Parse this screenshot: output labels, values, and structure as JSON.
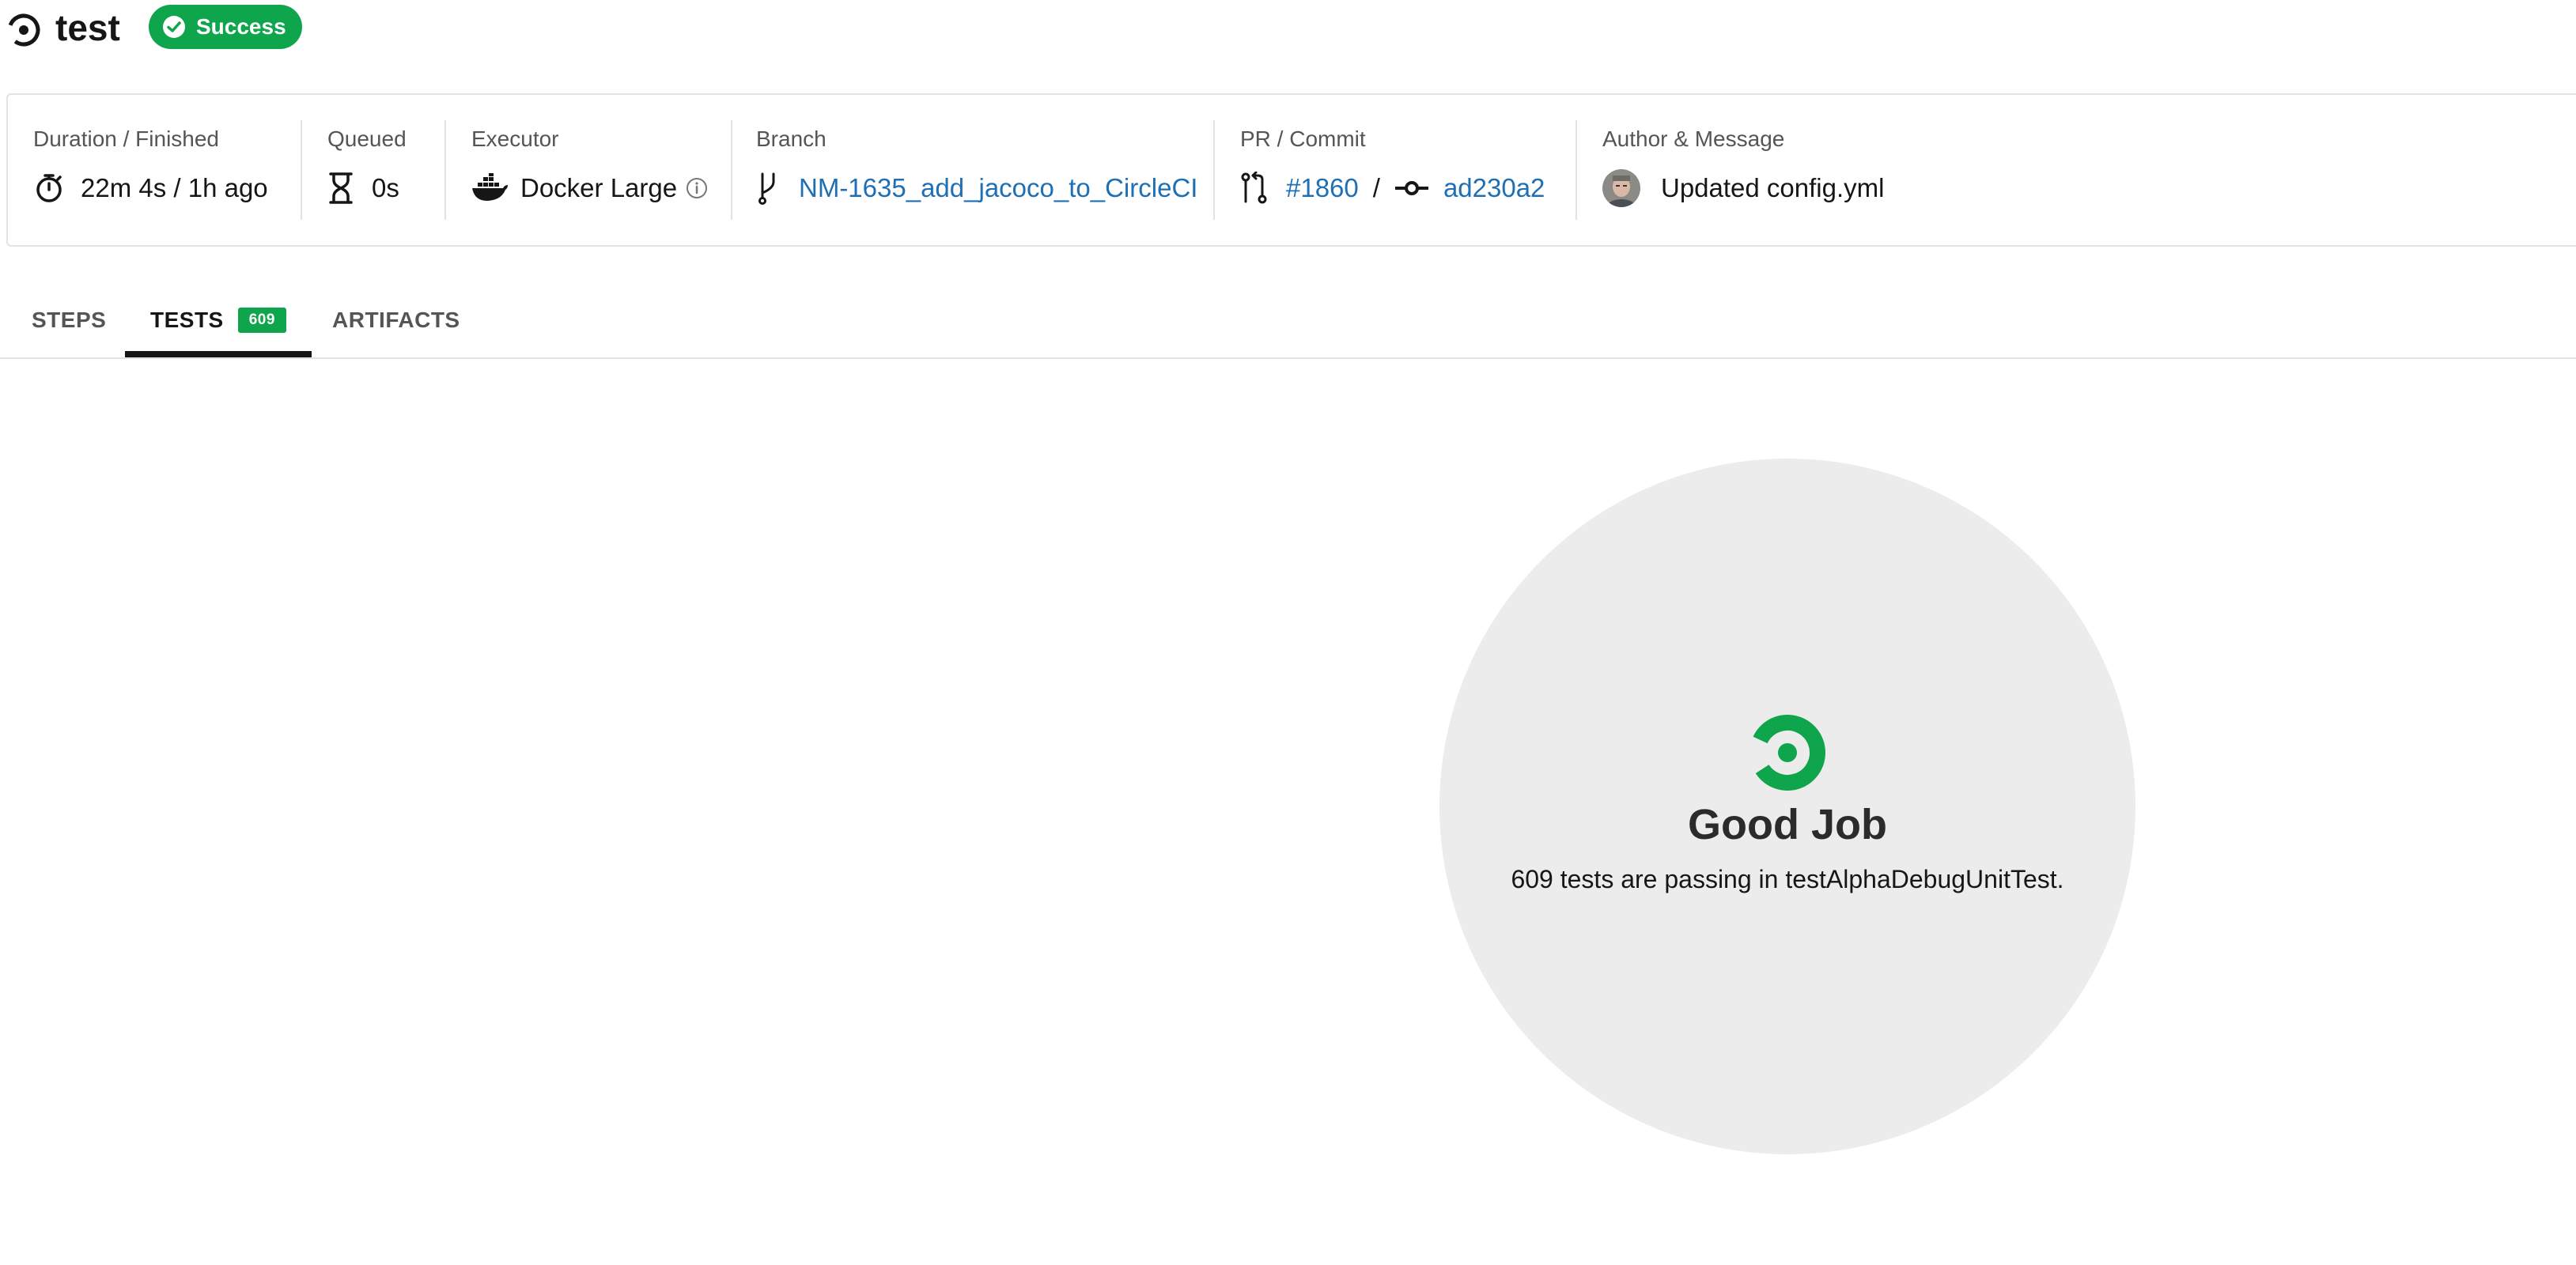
{
  "header": {
    "job_title": "test",
    "status": "Success",
    "status_color": "#0fa54d"
  },
  "info": {
    "duration": {
      "label": "Duration / Finished",
      "value": "22m 4s / 1h ago"
    },
    "queued": {
      "label": "Queued",
      "value": "0s"
    },
    "executor": {
      "label": "Executor",
      "value": "Docker Large"
    },
    "branch": {
      "label": "Branch",
      "value": "NM-1635_add_jacoco_to_CircleCI"
    },
    "pr_commit": {
      "label": "PR / Commit",
      "pr": "#1860",
      "separator": "/",
      "commit": "ad230a2"
    },
    "author": {
      "label": "Author & Message",
      "message": "Updated config.yml"
    }
  },
  "tabs": [
    {
      "label": "STEPS"
    },
    {
      "label": "TESTS",
      "count": "609"
    },
    {
      "label": "ARTIFACTS"
    }
  ],
  "active_tab": "TESTS",
  "empty_state": {
    "title": "Good Job",
    "message": "609 tests are passing in testAlphaDebugUnitTest."
  },
  "icons": {
    "job": "circleci-logo-icon",
    "status": "check-circle-icon",
    "duration": "stopwatch-icon",
    "queued": "hourglass-icon",
    "executor": "docker-icon",
    "executor_info": "info-icon",
    "branch": "branch-icon",
    "pr": "pull-request-icon",
    "commit": "commit-icon",
    "author": "avatar",
    "empty_state": "circleci-logo-icon"
  },
  "colors": {
    "accent_green": "#0fa54d",
    "link_blue": "#1f6fb4"
  }
}
